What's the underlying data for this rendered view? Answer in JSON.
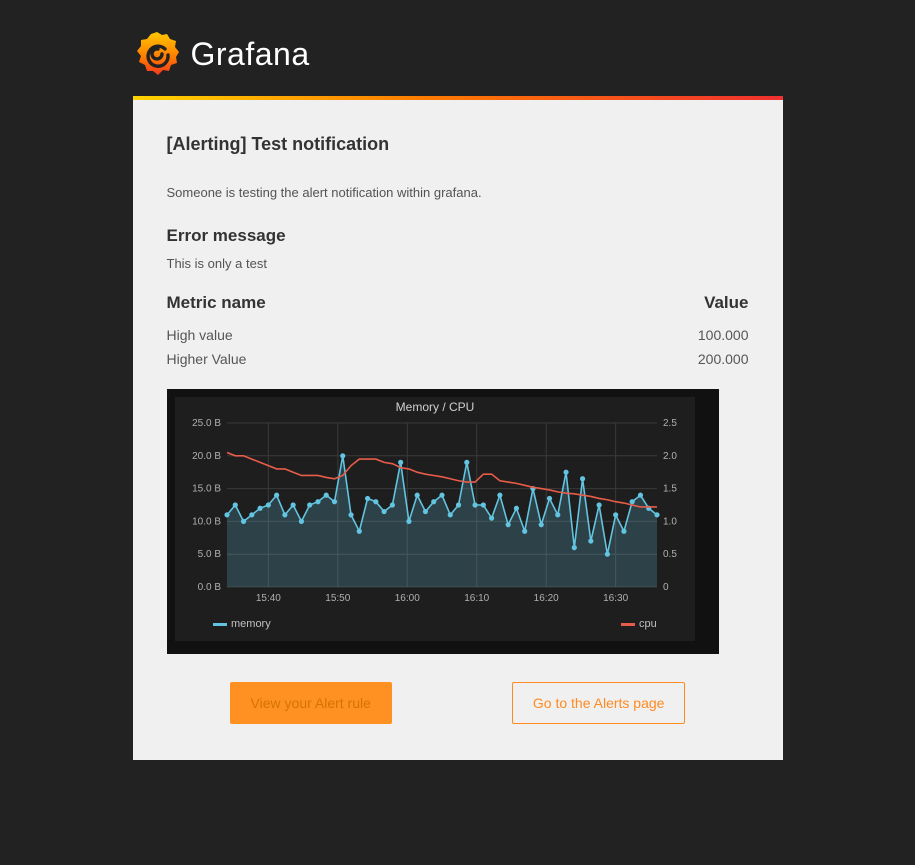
{
  "brand": {
    "name": "Grafana"
  },
  "alert": {
    "title": "[Alerting] Test notification",
    "description": "Someone is testing the alert notification within grafana.",
    "error_heading": "Error message",
    "error_body": "This is only a test"
  },
  "metrics": {
    "col_name": "Metric name",
    "col_value": "Value",
    "rows": [
      {
        "name": "High value",
        "value": "100.000"
      },
      {
        "name": "Higher Value",
        "value": "200.000"
      }
    ]
  },
  "chart_data": {
    "type": "line",
    "title": "Memory / CPU",
    "x_categories": [
      "15:40",
      "15:50",
      "16:00",
      "16:10",
      "16:20",
      "16:30"
    ],
    "y_left": {
      "ticks": [
        "0.0 B",
        "5.0 B",
        "10.0 B",
        "15.0 B",
        "20.0 B",
        "25.0 B"
      ],
      "min": 0,
      "max": 25
    },
    "y_right": {
      "ticks": [
        "0",
        "0.5",
        "1.0",
        "1.5",
        "2.0",
        "2.5"
      ],
      "min": 0,
      "max": 2.5
    },
    "legend": [
      {
        "name": "memory",
        "color": "#62C4E0"
      },
      {
        "name": "cpu",
        "color": "#E85C4A"
      }
    ],
    "series": [
      {
        "name": "memory",
        "axis": "left",
        "values": [
          11,
          12.5,
          10,
          11,
          12,
          12.5,
          14,
          11,
          12.5,
          10,
          12.5,
          13,
          14,
          13,
          20,
          11,
          8.5,
          13.5,
          13,
          11.5,
          12.5,
          19,
          10,
          14,
          11.5,
          13,
          14,
          11,
          12.5,
          19,
          12.5,
          12.5,
          10.5,
          14,
          9.5,
          12,
          8.5,
          15,
          9.5,
          13.5,
          11,
          17.5,
          6,
          16.5,
          7,
          12.5,
          5,
          11,
          8.5,
          13,
          14,
          12,
          11
        ]
      },
      {
        "name": "cpu",
        "axis": "right",
        "values": [
          2.05,
          2.0,
          2.0,
          1.95,
          1.9,
          1.85,
          1.8,
          1.8,
          1.75,
          1.7,
          1.7,
          1.7,
          1.67,
          1.65,
          1.7,
          1.85,
          1.95,
          1.95,
          1.95,
          1.9,
          1.88,
          1.82,
          1.8,
          1.75,
          1.72,
          1.7,
          1.68,
          1.65,
          1.62,
          1.6,
          1.6,
          1.72,
          1.72,
          1.62,
          1.6,
          1.58,
          1.55,
          1.52,
          1.5,
          1.48,
          1.45,
          1.43,
          1.42,
          1.4,
          1.38,
          1.35,
          1.33,
          1.3,
          1.28,
          1.25,
          1.22,
          1.22,
          1.22
        ]
      }
    ],
    "note": "53 equally spaced samples spanning ~15:35 → ~16:31"
  },
  "buttons": {
    "primary": "View your Alert rule",
    "secondary": "Go to the Alerts page"
  }
}
